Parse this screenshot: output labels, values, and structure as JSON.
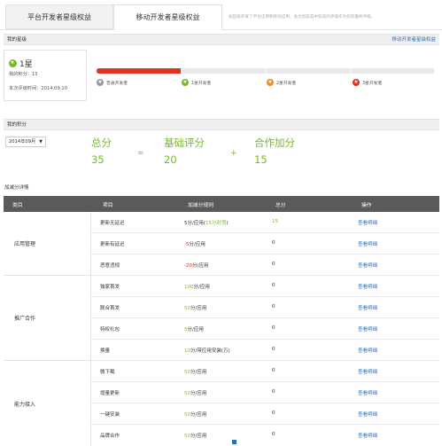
{
  "tabs": [
    "平台开发者星级权益",
    "移动开发者星级权益"
  ],
  "tip": "如您既开发了平台应用和移动应用，会为您取其中较高的评级作为您的最终评级。",
  "my_level": {
    "title": "我的星级",
    "link": "移动开发者星级权益",
    "level": "1星",
    "score_label": "我的积分：15",
    "date_label": "本次评级时间：2014.09.10",
    "progress_percent": 25,
    "levels": [
      "普通开发者",
      "1星开发者",
      "2星开发者",
      "3星开发者"
    ]
  },
  "my_score": {
    "title": "我的积分",
    "month": "2014年09月",
    "total_label": "总分",
    "total": "35",
    "eq": "=",
    "base_label": "基础评分",
    "base": "20",
    "plus": "+",
    "coop_label": "合作加分",
    "coop": "15"
  },
  "detail_title": "加减分详情",
  "table": {
    "headers": [
      "类目",
      "项目",
      "加减分规则",
      "总分",
      "操作"
    ],
    "categories": [
      "应用管理",
      "推广合作",
      "能力接入"
    ],
    "rows": [
      {
        "item": "更新无延迟",
        "rule_a": "5分/应用(",
        "rule_b": "15分封顶",
        "rule_c": ")",
        "score": "15",
        "action": "查看明细"
      },
      {
        "item": "更新有延迟",
        "rule_a": "-5",
        "rule_b": "分/应用",
        "rule_c": "",
        "score": "0",
        "action": "查看明细"
      },
      {
        "item": "恶意违规",
        "rule_a": "-20",
        "rule_b": "分/应用",
        "rule_c": "",
        "score": "0",
        "action": "查看明细"
      },
      {
        "item": "独家首发",
        "rule_a": "100",
        "rule_b": "分/应用",
        "rule_c": "",
        "score": "0",
        "action": "查看明细"
      },
      {
        "item": "联合首发",
        "rule_a": "50",
        "rule_b": "分/应用",
        "rule_c": "",
        "score": "0",
        "action": "查看明细"
      },
      {
        "item": "特权礼包",
        "rule_a": "5",
        "rule_b": "分/应用",
        "rule_c": "",
        "score": "0",
        "action": "查看明细"
      },
      {
        "item": "换量",
        "rule_a": "10",
        "rule_b": "分/带应用安装(万)",
        "rule_c": "",
        "score": "0",
        "action": "查看明细"
      },
      {
        "item": "微下载",
        "rule_a": "50",
        "rule_b": "分/应用",
        "rule_c": "",
        "score": "0",
        "action": "查看明细"
      },
      {
        "item": "增量更新",
        "rule_a": "50",
        "rule_b": "分/应用",
        "rule_c": "",
        "score": "0",
        "action": "查看明细"
      },
      {
        "item": "一键安装",
        "rule_a": "50",
        "rule_b": "分/应用",
        "rule_c": "",
        "score": "0",
        "action": "查看明细"
      },
      {
        "item": "品牌合作",
        "rule_a": "50",
        "rule_b": "分/应用",
        "rule_c": "",
        "score": "0",
        "action": "查看明细"
      }
    ]
  }
}
